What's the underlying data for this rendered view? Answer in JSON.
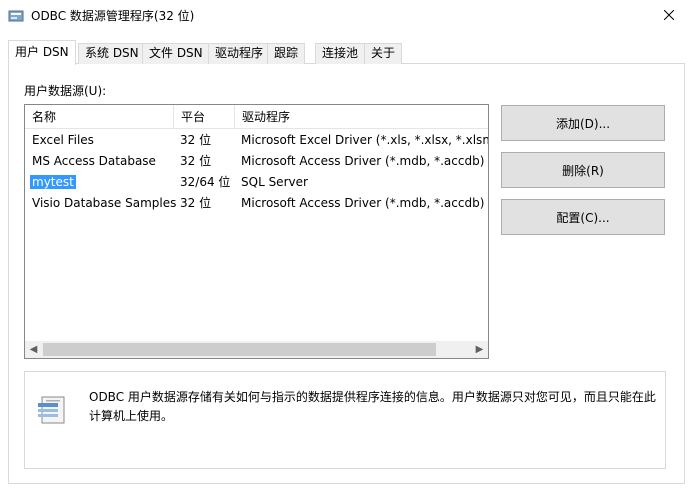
{
  "window": {
    "title": "ODBC 数据源管理程序(32 位)"
  },
  "tabs": [
    {
      "label": "用户 DSN"
    },
    {
      "label": "系统 DSN"
    },
    {
      "label": "文件 DSN"
    },
    {
      "label": "驱动程序"
    },
    {
      "label": "跟踪"
    },
    {
      "label": "连接池"
    },
    {
      "label": "关于"
    }
  ],
  "list": {
    "label": "用户数据源(U):",
    "columns": [
      "名称",
      "平台",
      "驱动程序"
    ],
    "rows": [
      {
        "name": "Excel Files",
        "platform": "32 位",
        "driver": "Microsoft Excel Driver (*.xls, *.xlsx, *.xlsm, *"
      },
      {
        "name": "MS Access Database",
        "platform": "32 位",
        "driver": "Microsoft Access Driver (*.mdb, *.accdb)"
      },
      {
        "name": "mytest",
        "platform": "32/64 位",
        "driver": "SQL Server"
      },
      {
        "name": "Visio Database Samples",
        "platform": "32 位",
        "driver": "Microsoft Access Driver (*.mdb, *.accdb)"
      }
    ],
    "selected_index": 2
  },
  "buttons": {
    "add": "添加(D)...",
    "remove": "删除(R)",
    "configure": "配置(C)..."
  },
  "info": {
    "text": "ODBC 用户数据源存储有关如何与指示的数据提供程序连接的信息。用户数据源只对您可见，而且只能在此计算机上使用。"
  },
  "colors": {
    "selection": "#3399ff",
    "button_bg": "#e1e1e1",
    "border": "#d9d9d9"
  }
}
